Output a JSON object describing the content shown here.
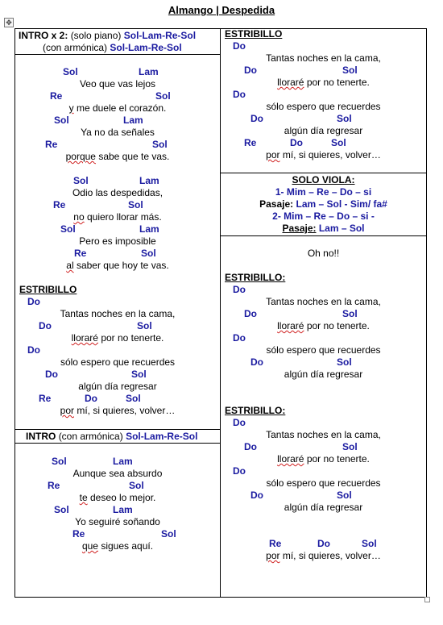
{
  "document": {
    "title": "Almango | Despedida",
    "move_glyph": "✥"
  },
  "left": {
    "intro_box": {
      "label": "INTRO x 2:",
      "mode1": "(solo piano)",
      "chords1": "Sol-Lam-Re-Sol",
      "mode2": "(con armónica)",
      "chords2": "Sol-Lam-Re-Sol"
    },
    "verse1": {
      "c1a": "Sol",
      "c1b": "Lam",
      "l1": "Veo que vas lejos",
      "c2a": "Re",
      "c2b": "Sol",
      "l2w": "y",
      "l2r": " me duele el corazón.",
      "c3a": "Sol",
      "c3b": "Lam",
      "l3": "Ya no da señales",
      "c4a": "Re",
      "c4b": "Sol",
      "l4w": "porque",
      "l4r": " sabe que te vas."
    },
    "verse2": {
      "c1a": "Sol",
      "c1b": "Lam",
      "l1": "Odio las despedidas,",
      "c2a": "Re",
      "c2b": "Sol",
      "l2w": "no",
      "l2r": " quiero llorar más.",
      "c3a": "Sol",
      "c3b": "Lam",
      "l3": "Pero es imposible",
      "c4a": "Re",
      "c4b": "Sol",
      "l4w": "al",
      "l4r": " saber que hoy te vas."
    },
    "chorus": {
      "heading": "ESTRIBILLO",
      "c1": "Do",
      "l1": "Tantas noches en la cama,",
      "c2a": "Do",
      "c2b": "Sol",
      "l2w": "lloraré",
      "l2r": " por no tenerte.",
      "c3": "Do",
      "l3": "sólo espero que recuerdes",
      "c4a": "Do",
      "c4b": "Sol",
      "l4": "algún día regresar",
      "c5a": "Re",
      "c5b": "Do",
      "c5c": "Sol",
      "l5w": "por",
      "l5r": " mí, si quieres, volver…"
    },
    "intro2_box": {
      "label": "INTRO",
      "mode": "(con armónica)",
      "chords": "Sol-Lam-Re-Sol"
    },
    "verse3": {
      "c1a": "Sol",
      "c1b": "Lam",
      "l1": "Aunque sea absurdo",
      "c2a": "Re",
      "c2b": "Sol",
      "l2w": "te",
      "l2r": " deseo lo mejor.",
      "c3a": "Sol",
      "c3b": "Lam",
      "l3": "Yo seguiré soñando",
      "c4a": "Re",
      "c4b": "Sol",
      "l4w": "que",
      "l4r": " sigues aquí."
    }
  },
  "right": {
    "chorus1": {
      "heading": "ESTRIBILLO",
      "c1": "Do",
      "l1": "Tantas noches en la cama,",
      "c2a": "Do",
      "c2b": "Sol",
      "l2w": "lloraré",
      "l2r": " por no tenerte.",
      "c3": "Do",
      "l3": "sólo espero que recuerdes",
      "c4a": "Do",
      "c4b": "Sol",
      "l4": "algún día regresar",
      "c5a": "Re",
      "c5b": "Do",
      "c5c": "Sol",
      "l5w": "por",
      "l5r": " mí, si quieres, volver…"
    },
    "solo_box": {
      "heading": "SOLO VIOLA:",
      "line1": "1- Mim – Re – Do – si",
      "pasaje1_label": "Pasaje:",
      "pasaje1": " Lam – Sol - Sim/ fa#",
      "line2": "2- Mim – Re – Do – si -",
      "pasaje2_label": "Pasaje:",
      "pasaje2": " Lam – Sol"
    },
    "oh_no": "Oh no!!",
    "chorus2": {
      "heading": "ESTRIBILLO:",
      "c1": "Do",
      "l1": "Tantas noches en la cama,",
      "c2a": "Do",
      "c2b": "Sol",
      "l2w": "lloraré",
      "l2r": " por no tenerte.",
      "c3": "Do",
      "l3": "sólo espero que recuerdes",
      "c4a": "Do",
      "c4b": "Sol",
      "l4": "algún día regresar"
    },
    "chorus3": {
      "heading": "ESTRIBILLO:",
      "c1": "Do",
      "l1": "Tantas noches en la cama,",
      "c2a": "Do",
      "c2b": "Sol",
      "l2w": "lloraré",
      "l2r": " por no tenerte.",
      "c3": "Do",
      "l3": "sólo espero que recuerdes",
      "c4a": "Do",
      "c4b": "Sol",
      "l4": "algún día regresar",
      "c5a": "Re",
      "c5b": "Do",
      "c5c": "Sol",
      "l5w": "por",
      "l5r": " mí, si quieres, volver…"
    }
  }
}
